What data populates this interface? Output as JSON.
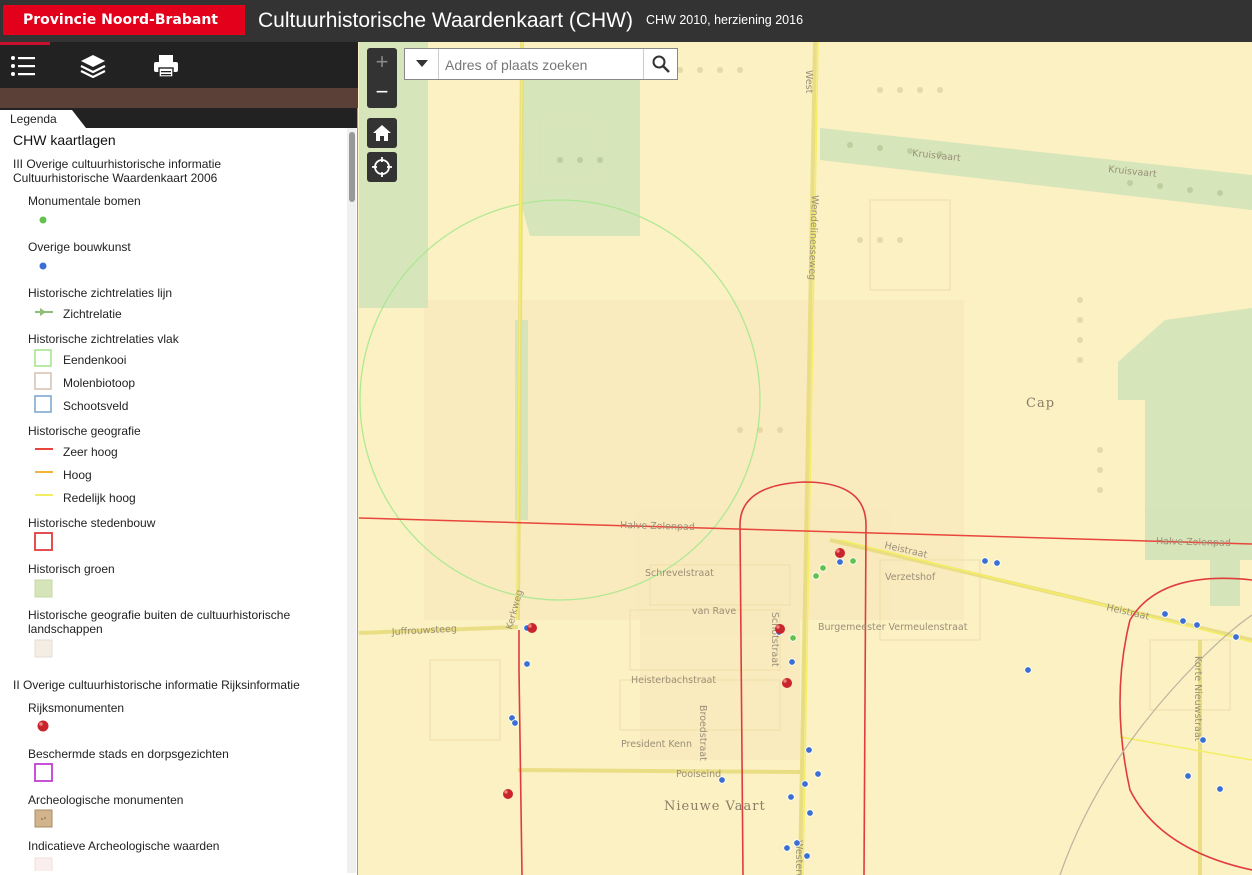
{
  "header": {
    "brand": "Provincie Noord-Brabant",
    "title": "Cultuurhistorische Waardenkaart (CHW)",
    "subtitle": "CHW 2010, herziening 2016"
  },
  "toolbar": {
    "items": [
      {
        "icon": "legend-list-icon"
      },
      {
        "icon": "layers-icon"
      },
      {
        "icon": "print-icon"
      }
    ]
  },
  "panel": {
    "tab": "Legenda",
    "title": "CHW kaartlagen",
    "group1_line1": "III Overige cultuurhistorische informatie",
    "group1_line2": "Cultuurhistorische Waardenkaart 2006",
    "monumentale_bomen": "Monumentale bomen",
    "overige_bouwkunst": "Overige bouwkunst",
    "zichtrelaties_lijn": "Historische zichtrelaties lijn",
    "zichtrelatie": "Zichtrelatie",
    "zichtrelaties_vlak": "Historische zichtrelaties vlak",
    "eendenkooi": "Eendenkooi",
    "molenbiotoop": "Molenbiotoop",
    "schootsveld": "Schootsveld",
    "historische_geografie": "Historische geografie",
    "zeer_hoog": "Zeer hoog",
    "hoog": "Hoog",
    "redelijk_hoog": "Redelijk hoog",
    "stedenbouw": "Historische stedenbouw",
    "groen": "Historisch groen",
    "buiten_line1": "Historische geografie buiten de cultuurhistorische",
    "buiten_line2": "landschappen",
    "group2": "II Overige cultuurhistorische informatie Rijksinformatie",
    "rijksmonumenten": "Rijksmonumenten",
    "beschermde": "Beschermde stads en dorpsgezichten",
    "archeologische": "Archeologische monumenten",
    "indicatieve": "Indicatieve Archeologische waarden"
  },
  "legend_colors": {
    "tree_point": "#62c24e",
    "building_point": "#3b6fd1",
    "sightline": "#8ec07a",
    "eendenkooi": "#a6e88f",
    "molenbiotoop": "#d8c4b6",
    "schootsveld": "#7fa8d2",
    "zeer_hoog": "#e8463c",
    "hoog": "#f0b53a",
    "redelijk_hoog": "#f4ee63",
    "stedenbouw": "#e03c3c",
    "groen": "#d5e4b9",
    "buiten": "#f4ede4",
    "rijksmonument": "#c8262c",
    "beschermde": "#c13fd1",
    "archeologisch": "#d2b48c"
  },
  "search": {
    "placeholder": "Adres of plaats zoeken"
  },
  "map": {
    "zoom_in": "+",
    "zoom_out": "−",
    "home_icon": "home-icon",
    "locate_icon": "locate-icon",
    "labels": {
      "west": "West",
      "kruisvaart_1": "Kruisvaart",
      "kruisvaart_2": "Kruisvaart",
      "wendelijnweg": "Wendelinesseweg",
      "cap": "Cap",
      "halve_zolenpad": "Halve Zolenpad",
      "halve_zolenpad_2": "Halve Zolenpad",
      "heistraat": "Heistraat",
      "heistraat_2": "Heistraat",
      "schrevelstraat": "Schrevelstraat",
      "verzetshof": "Verzetshof",
      "van_rave": "van Rave",
      "schotstraat": "Schotstraat",
      "burgemeester": "Burgemeester Vermeulenstraat",
      "juffrouwsteeg": "Juffrouwsteeg",
      "kerkweg": "Kerkweg",
      "heisterbachstraat": "Heisterbachstraat",
      "broedstraat": "Broedstraat",
      "president": "President Kenn",
      "pooiseind": "Pooiseind",
      "nieuwe_vaart": "Nieuwe Vaart",
      "korte_nieuwstraat": "Korte Nieuwstraat",
      "westerweg": "Westerweg"
    }
  }
}
